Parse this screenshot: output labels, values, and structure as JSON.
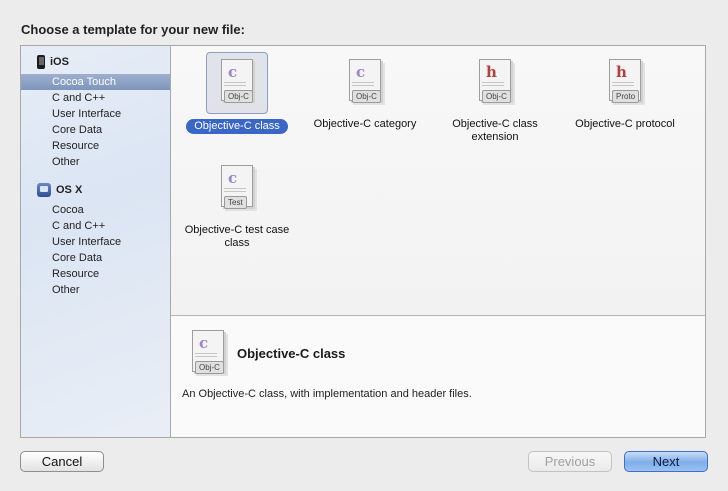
{
  "heading": "Choose a template for your new file:",
  "sidebar": {
    "groups": [
      {
        "label": "iOS",
        "icon": "iphone-icon",
        "items": [
          "Cocoa Touch",
          "C and C++",
          "User Interface",
          "Core Data",
          "Resource",
          "Other"
        ],
        "selected": "Cocoa Touch"
      },
      {
        "label": "OS X",
        "icon": "mac-icon",
        "items": [
          "Cocoa",
          "C and C++",
          "User Interface",
          "Core Data",
          "Resource",
          "Other"
        ]
      }
    ]
  },
  "templates": [
    {
      "label": "Objective-C class",
      "icon_letter": "c",
      "icon_tag": "Obj-C",
      "selected": true
    },
    {
      "label": "Objective-C category",
      "icon_letter": "c",
      "icon_tag": "Obj-C"
    },
    {
      "label": "Objective-C class extension",
      "icon_letter": "h",
      "icon_tag": "Obj-C"
    },
    {
      "label": "Objective-C protocol",
      "icon_letter": "h",
      "icon_tag": "Proto"
    },
    {
      "label": "Objective-C test case class",
      "icon_letter": "c",
      "icon_tag": "Test"
    }
  ],
  "description": {
    "title": "Objective-C class",
    "icon_letter": "c",
    "icon_tag": "Obj-C",
    "text": "An Objective-C class, with implementation and header files."
  },
  "buttons": {
    "cancel": "Cancel",
    "previous": "Previous",
    "next": "Next"
  },
  "colors": {
    "selection_blue": "#3a66c6",
    "sidebar_selection": "#8ea2c6",
    "default_button": "#7faeea"
  }
}
